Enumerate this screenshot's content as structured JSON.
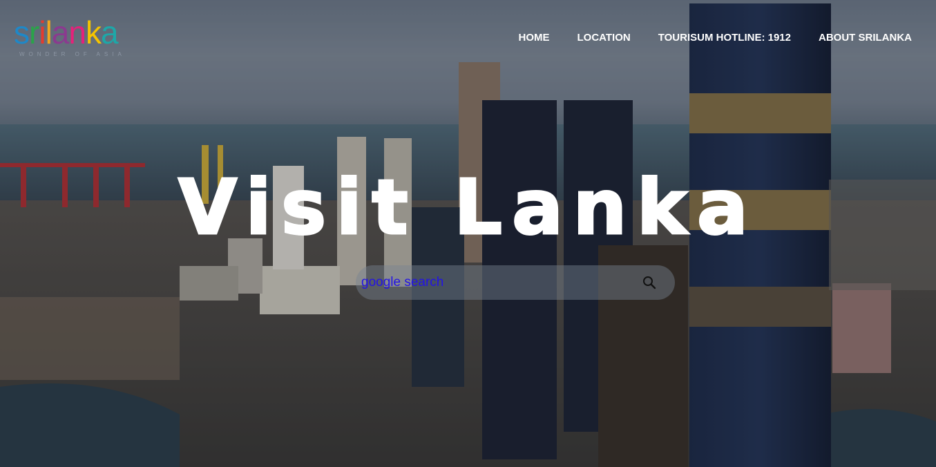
{
  "logo": {
    "letters": [
      {
        "ch": "s",
        "color": "#1e88c8"
      },
      {
        "ch": "r",
        "color": "#2aa34a"
      },
      {
        "ch": "i",
        "color": "#e63b2e"
      },
      {
        "ch": "l",
        "color": "#f2a81d"
      },
      {
        "ch": "a",
        "color": "#8b3a8f"
      },
      {
        "ch": "n",
        "color": "#e6217a"
      },
      {
        "ch": "k",
        "color": "#f5c400"
      },
      {
        "ch": "a",
        "color": "#1ea7a8"
      }
    ],
    "tagline": "WONDER OF ASIA"
  },
  "nav": {
    "items": [
      {
        "label": "HOME"
      },
      {
        "label": "LOCATION"
      },
      {
        "label": "TOURISUM HOTLINE: 1912"
      },
      {
        "label": "ABOUT SRILANKA"
      }
    ]
  },
  "hero": {
    "title": "Visit Lanka"
  },
  "search": {
    "placeholder": "google search",
    "value": "",
    "button_icon": "search-icon"
  },
  "colors": {
    "nav_text": "#ffffff",
    "search_text": "#2313e6",
    "search_bg": "rgba(120,130,145,0.45)"
  }
}
